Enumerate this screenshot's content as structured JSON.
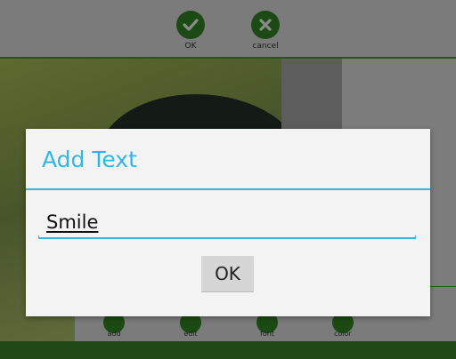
{
  "toolbar": {
    "ok_label": "OK",
    "cancel_label": "cancel"
  },
  "bottom_tools": [
    {
      "label": "add"
    },
    {
      "label": "edit"
    },
    {
      "label": "font"
    },
    {
      "label": "color"
    }
  ],
  "dialog": {
    "title": "Add Text",
    "input_value": "Smile",
    "ok_label": "OK"
  },
  "colors": {
    "accent": "#33b5e5",
    "app_green": "#1c4a14"
  }
}
